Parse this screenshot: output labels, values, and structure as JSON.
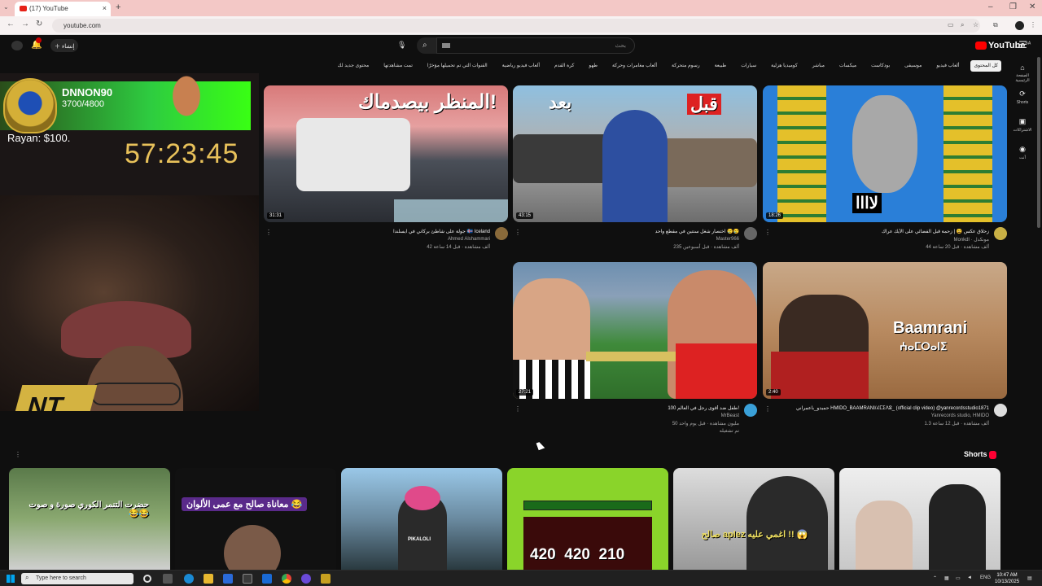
{
  "browser": {
    "tab_title": "(17) YouTube",
    "url": "youtube.com",
    "tab_close": "×",
    "new_tab": "+"
  },
  "youtube": {
    "create_label": "إنشاء",
    "search_placeholder": "بحث",
    "logo_text": "YouTube",
    "logo_region": "SA",
    "chips": [
      "كل المحتوى",
      "ألعاب فيديو",
      "موسيقى",
      "بودكاست",
      "ميكسات",
      "مباشر",
      "كوميديا هزلية",
      "سيارات",
      "طبيعة",
      "رسوم متحركة",
      "ألعاب مغامرات وحركة",
      "طهو",
      "كرة القدم",
      "ألعاب فيديو رياضية",
      "القنوات التي تم تحميلها مؤخرًا",
      "تمت مشاهدتها",
      "محتوى جديد لك"
    ],
    "sidenav": [
      {
        "icon": "home-icon",
        "glyph": "⌂",
        "label": "الصفحة الرئيسية"
      },
      {
        "icon": "shorts-icon",
        "glyph": "⟳",
        "label": "Shorts"
      },
      {
        "icon": "subscriptions-icon",
        "glyph": "▣",
        "label": "الاشتراكات"
      },
      {
        "icon": "you-icon",
        "glyph": "◉",
        "label": "أنت"
      }
    ],
    "videos": [
      {
        "thumb_text": "المنظر بيصدماك!",
        "duration": "31:31",
        "title": "جولة على شاطئ بركاني في آيسلندا 🇮🇸 Iceland",
        "channel": "Ahmed Alshammari",
        "stats": "42 ألف مشاهدة · قبل 14 ساعة"
      },
      {
        "thumb_text_a": "بعد",
        "thumb_text_b": "قبل",
        "duration": "43:15",
        "title": "اختصار شغل سنتين في مقطع واحد 😢😢",
        "channel": "Master966",
        "stats": "235 ألف مشاهدة · قبل أسبوعين"
      },
      {
        "thumb_text": "لاااا",
        "duration": "18:26",
        "title": "زحلاق عكس 😩 | زحمة قبل الفضائي على الآيك عراك",
        "channel": "Monkdl · مونكدل",
        "stats": "44 ألف مشاهدة · قبل 20 ساعة"
      },
      {
        "duration": "27:21",
        "title": "100 طفل ضد أقوى رجل في العالم!",
        "channel": "MrBeast",
        "stats": "50 مليون مشاهدة · قبل يوم واحد",
        "extra": "تم تشغيله"
      },
      {
        "thumb_text": "Baamrani",
        "thumb_sub": "ⵄⴰⵎⵔⴰⵏⵉ",
        "duration": "2:40",
        "title": "حميدو_باعمراني HMIDO_BAAMRANI/ⵃⵎⵉⴷⵓ_ (official clip video) @yanrecordsstudio1871",
        "channel": "Yanrecords studio, HMIDO",
        "stats": "1.3 ألف مشاهدة · قبل 12 ساعة"
      }
    ],
    "shorts_heading": "Shorts",
    "shorts": [
      {
        "text": "حضرت التنمر الكوري صورة و صوت 😂😂"
      },
      {
        "text": "معاناة صالح مع عمى الألوان 😂"
      },
      {
        "text": "PIKALOLI"
      },
      {
        "text": "420  420  210"
      },
      {
        "text": "صالح aplez اغمي عليه !! 😱"
      },
      {
        "text": ""
      }
    ]
  },
  "overlay": {
    "player_name": "DNNON90",
    "player_score": "3700/4800",
    "donation": "Rayan: $100.",
    "timer": "57:23:45",
    "logo": "NT"
  },
  "taskbar": {
    "search_placeholder": "Type here to search",
    "lang": "ENG",
    "time": "10:47 AM",
    "date": "10/13/2025"
  },
  "colors": {
    "youtube_red": "#ff0000",
    "bg": "#0f0f0f",
    "timer": "#e8c15a"
  }
}
